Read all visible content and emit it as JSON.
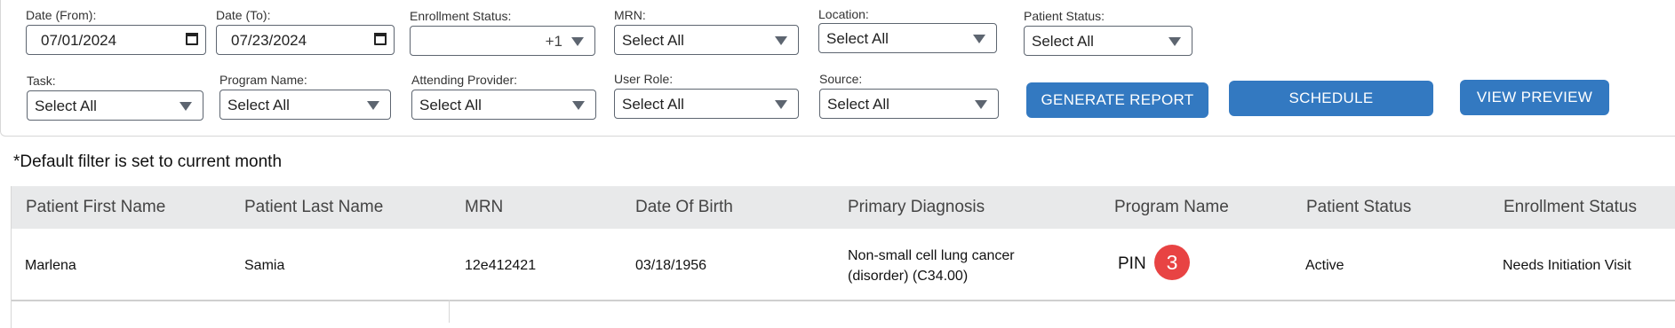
{
  "filters": {
    "date_from": {
      "label": "Date  (From):",
      "value": "07/01/2024"
    },
    "date_to": {
      "label": "Date  (To):",
      "value": "07/23/2024"
    },
    "enrollment_status": {
      "label": "Enrollment Status:",
      "value": "",
      "extra": "+1"
    },
    "mrn": {
      "label": "MRN:",
      "value": "Select All"
    },
    "location": {
      "label": "Location:",
      "value": "Select All"
    },
    "patient_status": {
      "label": "Patient Status:",
      "value": "Select All"
    },
    "task": {
      "label": "Task:",
      "value": "Select All"
    },
    "program_name": {
      "label": "Program Name:",
      "value": "Select All"
    },
    "attending_provider": {
      "label": "Attending Provider:",
      "value": "Select All"
    },
    "user_role": {
      "label": "User Role:",
      "value": "Select All"
    },
    "source": {
      "label": "Source:",
      "value": "Select All"
    }
  },
  "buttons": {
    "generate_report": "GENERATE REPORT",
    "schedule": "SCHEDULE",
    "view_preview": "VIEW PREVIEW"
  },
  "note": "*Default filter is set to current month",
  "table": {
    "headers": [
      "Patient First Name",
      "Patient Last Name",
      "MRN",
      "Date Of Birth",
      "Primary Diagnosis",
      "Program Name",
      "Patient Status",
      "Enrollment Status"
    ],
    "rows": [
      {
        "first_name": "Marlena",
        "last_name": "Samia",
        "mrn": "12e412421",
        "dob": "03/18/1956",
        "diagnosis_line1": "Non-small cell lung cancer",
        "diagnosis_line2": "(disorder) (C34.00)",
        "program": "PIN",
        "program_badge": "3",
        "patient_status": "Active",
        "enrollment_status": "Needs Initiation Visit"
      }
    ]
  },
  "colors": {
    "primary_button": "#3379c1",
    "badge": "#e84343",
    "header_bg": "#e8e9ea"
  },
  "icons": {
    "calendar": "calendar-icon",
    "dropdown": "caret-down-icon"
  }
}
